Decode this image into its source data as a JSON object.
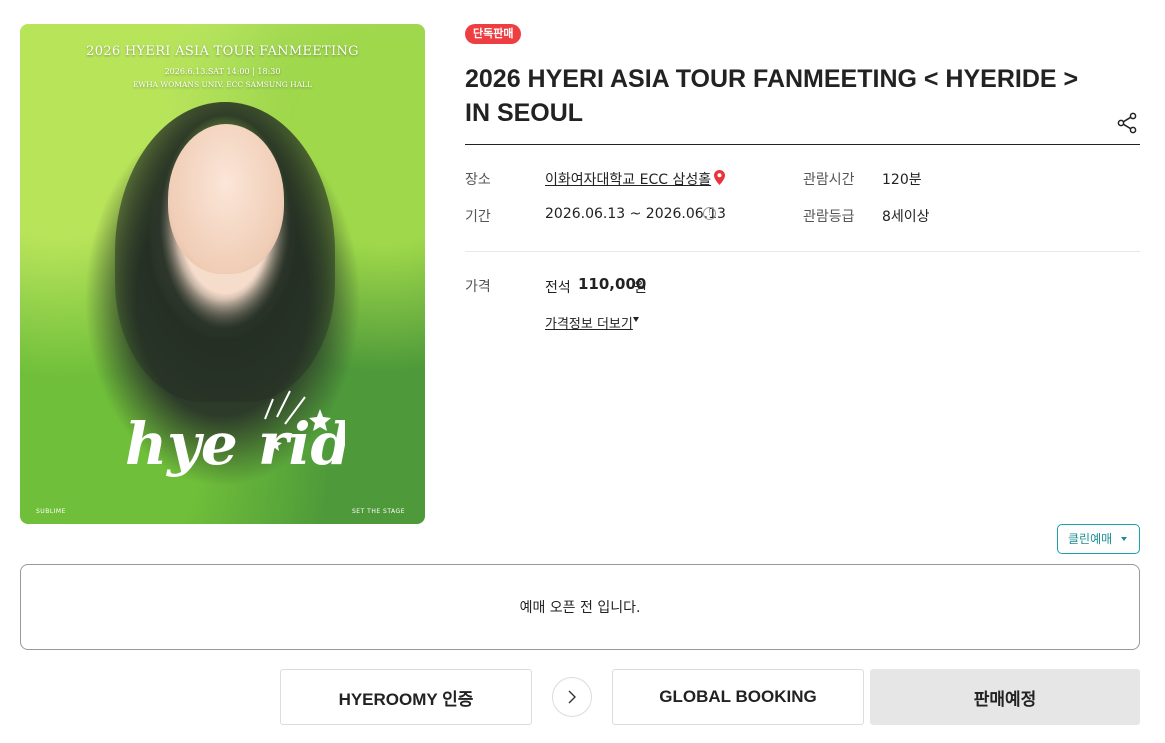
{
  "poster": {
    "title": "2026 HYERI ASIA TOUR FANMEETING",
    "date": "2026.6.13.SAT 14:00 | 18:30",
    "venue": "EWHA WOMANS UNIV. ECC SAMSUNG HALL",
    "logo_text": "hye ride",
    "footer_left": "SUBLIME",
    "footer_right": "SET THE STAGE"
  },
  "badge": "단독판매",
  "title_line1": "2026 HYERI ASIA TOUR FANMEETING < HYERIDE >",
  "title_line2": "IN SEOUL",
  "info": {
    "venue_label": "장소",
    "venue_value": "이화여자대학교 ECC 삼성홀",
    "period_label": "기간",
    "period_value": "2026.06.13 ~ 2026.06.13",
    "runtime_label": "관람시간",
    "runtime_value": "120분",
    "rating_label": "관람등급",
    "rating_value": "8세이상"
  },
  "price": {
    "label": "가격",
    "grade": "전석",
    "amount": "110,000",
    "unit": "원",
    "more": "가격정보 더보기"
  },
  "clean_booking": "클린예매",
  "notice": "예매 오픈 전 입니다.",
  "buttons": {
    "hyeroomy": "HYEROOMY 인증",
    "global": "GLOBAL BOOKING",
    "status": "판매예정"
  },
  "colors": {
    "badge": "#ef3e42",
    "clean_accent": "#1aa2a8",
    "status_bg": "#e6e6e6"
  }
}
